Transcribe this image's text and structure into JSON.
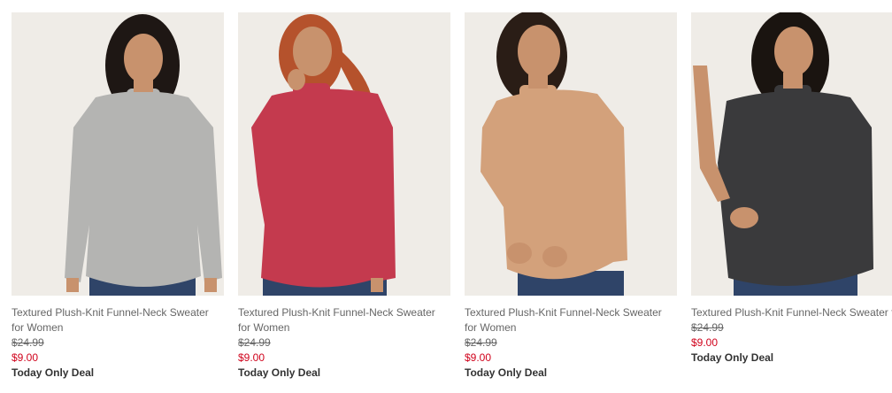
{
  "products": [
    {
      "title": "Textured Plush-Knit Funnel-Neck Sweater for Women",
      "original_price": "$24.99",
      "sale_price": "$9.00",
      "deal_label": "Today Only Deal",
      "sweater_color": "#b4b4b2",
      "hair_color": "#1e1714"
    },
    {
      "title": "Textured Plush-Knit Funnel-Neck Sweater for Women",
      "original_price": "$24.99",
      "sale_price": "$9.00",
      "deal_label": "Today Only Deal",
      "sweater_color": "#c43a4e",
      "hair_color": "#b5522c"
    },
    {
      "title": "Textured Plush-Knit Funnel-Neck Sweater for Women",
      "original_price": "$24.99",
      "sale_price": "$9.00",
      "deal_label": "Today Only Deal",
      "sweater_color": "#d3a17b",
      "hair_color": "#2a1d16"
    },
    {
      "title": "Textured Plush-Knit Funnel-Neck Sweater for Women",
      "original_price": "$24.99",
      "sale_price": "$9.00",
      "deal_label": "Today Only Deal",
      "sweater_color": "#3a3a3c",
      "hair_color": "#1a1410"
    }
  ],
  "colors": {
    "sale_price": "#d0021b",
    "text": "#666666",
    "photo_background": "#efece7",
    "skin": "#c8926d",
    "jeans": "#2f4468"
  }
}
